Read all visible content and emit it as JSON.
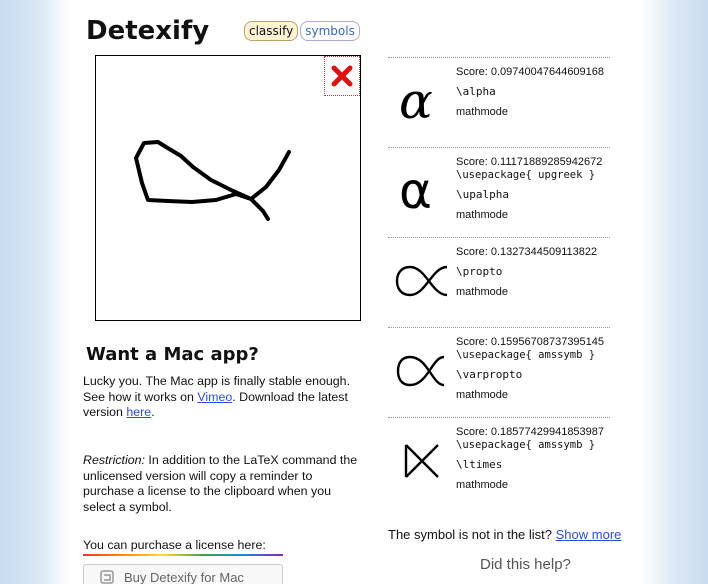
{
  "app": {
    "title": "Detexify"
  },
  "tabs": [
    {
      "label": "classify"
    },
    {
      "label": "symbols"
    }
  ],
  "canvas": {
    "clear_icon": "close-icon"
  },
  "mac": {
    "title": "Want a Mac app?",
    "p1_text": "Lucky you. The Mac app is finally stable enough. See how it works on ",
    "p1_link": "Vimeo",
    "p1_mid": ". Download the latest version ",
    "p1_link2": "here",
    "p1_end": ".",
    "p2_em": "Restriction:",
    "p2_text": " In addition to the LaTeX command the unlicensed version will copy a reminder to purchase a license to the clipboard when you select a symbol.",
    "p3_text": "You can purchase a license here:",
    "buy_label": "Buy Detexify for Mac"
  },
  "results": [
    {
      "score": "Score: 0.09740047644609168",
      "package": "",
      "command": "\\alpha",
      "mode": "mathmode"
    },
    {
      "score": "Score: 0.11171889285942672",
      "package": "\\usepackage{ upgreek }",
      "command": "\\upalpha",
      "mode": "mathmode"
    },
    {
      "score": "Score: 0.1327344509113822",
      "package": "",
      "command": "\\propto",
      "mode": "mathmode"
    },
    {
      "score": "Score: 0.15956708737395145",
      "package": "\\usepackage{ amssymb }",
      "command": "\\varpropto",
      "mode": "mathmode"
    },
    {
      "score": "Score: 0.18577429941853987",
      "package": "\\usepackage{ amssymb }",
      "command": "\\ltimes",
      "mode": "mathmode"
    }
  ],
  "footer": {
    "not_in_list": "The symbol is not in the list? ",
    "show_more": "Show more",
    "did_help": "Did this help?"
  },
  "colors": {
    "clear_icon": "#e01010",
    "link": "#2a4fd6",
    "tab_active_bg": "#fbf3d2"
  }
}
